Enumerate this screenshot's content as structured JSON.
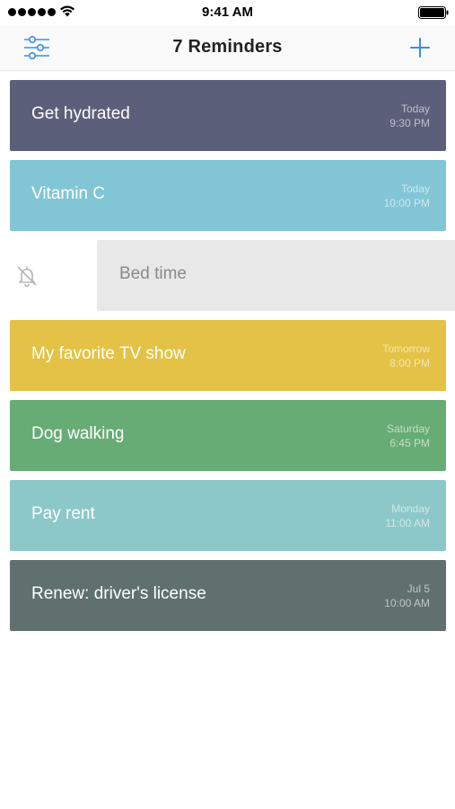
{
  "status_bar": {
    "time": "9:41 AM",
    "signal_icon": "signal-dots-icon",
    "wifi_icon": "wifi-icon",
    "battery_icon": "battery-icon"
  },
  "nav": {
    "title": "7 Reminders",
    "filter_icon": "sliders-icon",
    "add_icon": "plus-icon",
    "accent_color": "#3a8ee6"
  },
  "reminders": [
    {
      "title": "Get hydrated",
      "day": "Today",
      "time": "9:30 PM",
      "color": "#5b5f7a"
    },
    {
      "title": "Vitamin C",
      "day": "Today",
      "time": "10:00 PM",
      "color": "#82c6d6"
    },
    {
      "title": "Bed time",
      "day": "",
      "time": "",
      "color": "#e8e8e8",
      "swiped": true,
      "action_icon": "bell-off-icon"
    },
    {
      "title": "My favorite TV show",
      "day": "Tomorrow",
      "time": "8:00 PM",
      "color": "#e4c245"
    },
    {
      "title": "Dog walking",
      "day": "Saturday",
      "time": "6:45 PM",
      "color": "#67ac74"
    },
    {
      "title": "Pay rent",
      "day": "Monday",
      "time": "11:00 AM",
      "color": "#8dc8c8"
    },
    {
      "title": "Renew: driver's license",
      "day": "Jul 5",
      "time": "10:00 AM",
      "color": "#5f706f"
    }
  ]
}
